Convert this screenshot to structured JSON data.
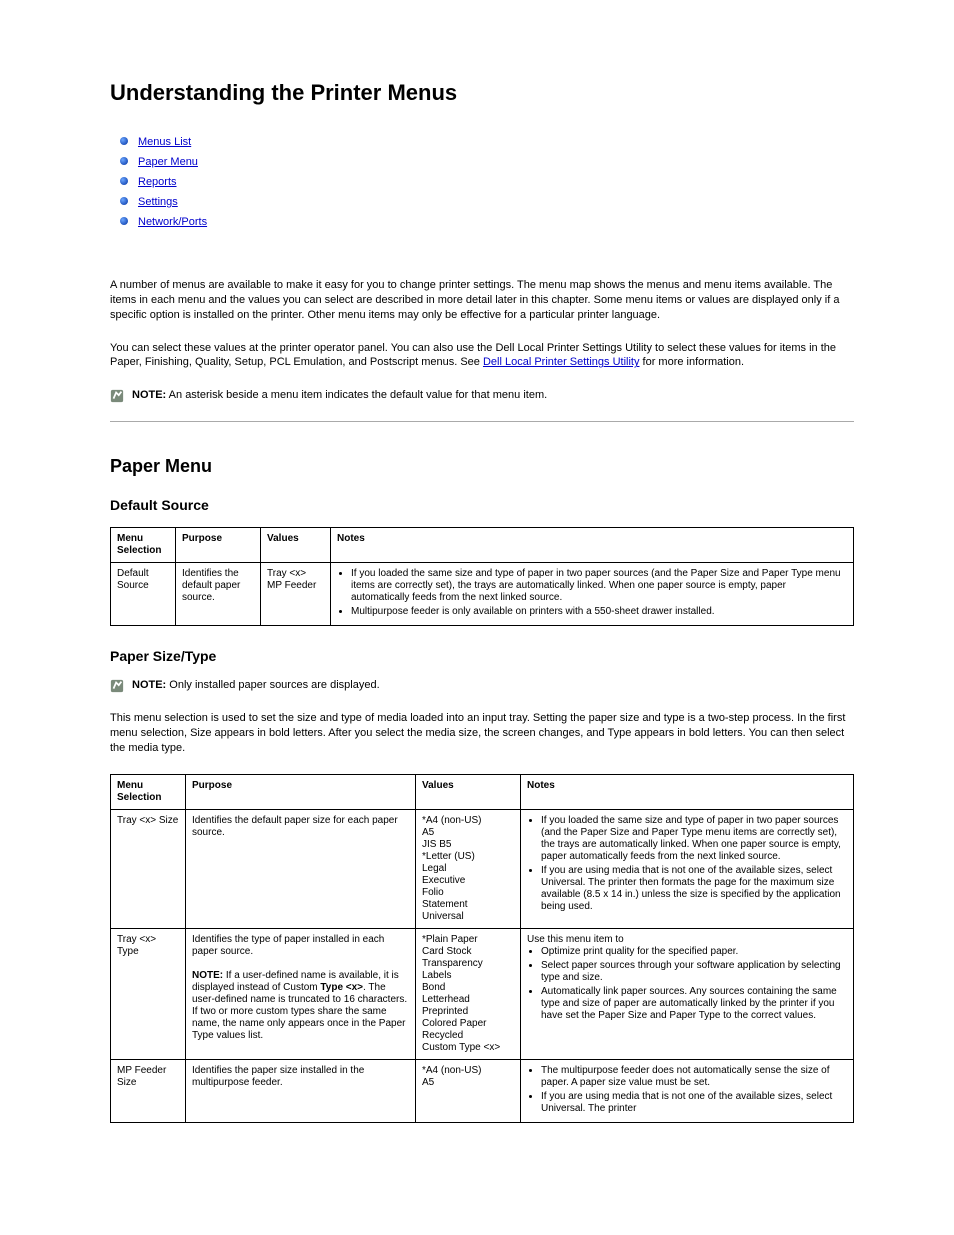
{
  "title": "Understanding the Printer Menus",
  "nav": [
    {
      "label": "Menus List"
    },
    {
      "label": "Paper Menu"
    },
    {
      "label": "Reports"
    },
    {
      "label": "Settings"
    },
    {
      "label": "Network/Ports"
    }
  ],
  "intro1": "A number of menus are available to make it easy for you to change printer settings. The menu map shows the menus and menu items available. The items in each menu and the values you can select are described in more detail later in this chapter. Some menu items or values are displayed only if a specific option is installed on the printer. Other menu items may only be effective for a particular printer language.",
  "intro2": "You can select these values at the printer operator panel. You can also use the Dell Local Printer Settings Utility to select these values for items in the Paper, Finishing, Quality, Setup, PCL Emulation, and Postscript menus. See ",
  "intro2_link": "Dell Local Printer Settings Utility",
  "intro2_after": " for more information.",
  "note1_label": "NOTE:",
  "note1_text": " An asterisk beside a menu item indicates the default value for that menu item.",
  "section_title": "Paper Menu",
  "subsection1": "Default Source",
  "table1": {
    "headers": [
      "Menu Selection",
      "Purpose",
      "Values",
      "Notes"
    ],
    "row": {
      "c1": "Default Source",
      "c2": "Identifies the default paper source.",
      "c3a": "Tray <x>",
      "c3b": "MP Feeder",
      "c4_items": [
        "If you loaded the same size and type of paper in two paper sources (and the Paper Size and Paper Type menu items are correctly set), the trays are automatically linked. When one paper source is empty, paper automatically feeds from the next linked source.",
        "Multipurpose feeder is only available on printers with a 550-sheet drawer installed."
      ]
    }
  },
  "subsection2": "Paper Size/Type",
  "note2_label": "NOTE:",
  "note2_text": " Only installed paper sources are displayed.",
  "para2": "This menu selection is used to set the size and type of media loaded into an input tray. Setting the paper size and type is a two-step process. In the first menu selection, Size appears in bold letters. After you select the media size, the screen changes, and Type appears in bold letters. You can then select the media type.",
  "table2": {
    "headers": [
      "Menu Selection",
      "Purpose",
      "Values",
      "Notes"
    ],
    "rows": [
      {
        "c1_pre": "Tray <x>",
        "c1_suf": " Size",
        "c2": "Identifies the default paper size for each paper source.",
        "c3": [
          "*A4 (non-US)",
          "A5",
          "JIS B5",
          "*Letter (US)",
          "Legal",
          "Executive",
          "Folio",
          "Statement",
          "Universal"
        ],
        "c4_items": [
          "If you loaded the same size and type of paper in two paper sources (and the Paper Size and Paper Type menu items are correctly set), the trays are automatically linked. When one paper source is empty, paper automatically feeds from the next linked source.",
          "If you are using media that is not one of the available sizes, select Universal. The printer then formats the page for the maximum size available (8.5 x 14 in.) unless the size is specified by the application being used."
        ]
      },
      {
        "c1_pre": "Tray <x>",
        "c1_suf": " Type",
        "c2a": "Identifies the type of paper installed in each paper source.",
        "c2b_label": "NOTE:",
        "c2b_text": " If a user-defined name is available, it is displayed instead of Custom ",
        "c2b_bold": "Type <x>",
        "c2b_after": ". The user-defined name is truncated to 16 characters. If two or more custom types share the same name, the name only appears once in the Paper Type values list.",
        "c3": [
          "*Plain Paper",
          "Card Stock",
          "Transparency",
          "Labels",
          "Bond",
          "Letterhead",
          "Preprinted",
          "Colored Paper",
          "Recycled",
          "Custom "
        ],
        "c3_suffix": "Type <x>",
        "c4_pre": "Use this menu item to",
        "c4_items": [
          "Optimize print quality for the specified paper.",
          "Select paper sources through your software application by selecting type and size.",
          "Automatically link paper sources. Any sources containing the same type and size of paper are automatically linked by the printer if you have set the Paper Size and Paper Type to the correct values."
        ]
      },
      {
        "c1": "MP Feeder Size",
        "c2": "Identifies the paper size installed in the multipurpose feeder.",
        "c3": [
          "*A4 (non-US)",
          "A5"
        ],
        "c4_items": [
          "The multipurpose feeder does not automatically sense the size of paper. A paper size value must be set.",
          "If you are using media that is not one of the available sizes, select Universal. The printer"
        ]
      }
    ]
  }
}
